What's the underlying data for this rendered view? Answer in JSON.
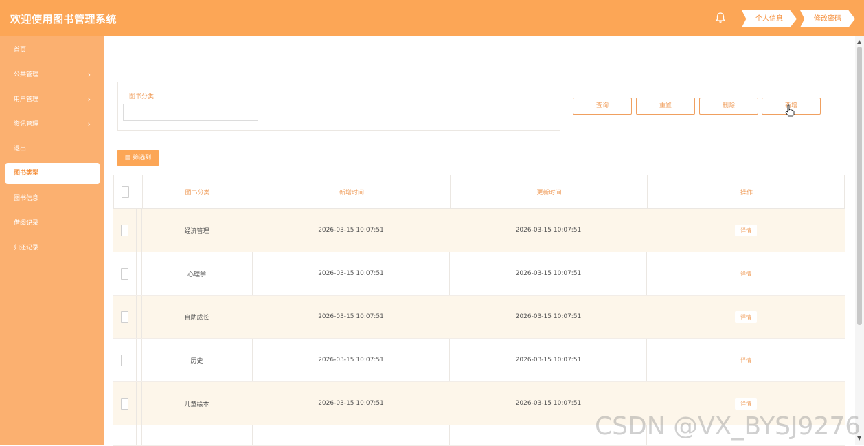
{
  "header": {
    "title": "欢迎使用图书管理系统",
    "profile_label": "个人信息",
    "password_label": "修改密码",
    "bell_icon": "bell-icon"
  },
  "sidebar": {
    "items": [
      {
        "label": "首页",
        "chevron": false
      },
      {
        "label": "公共管理",
        "chevron": true
      },
      {
        "label": "用户管理",
        "chevron": true
      },
      {
        "label": "资讯管理",
        "chevron": true
      },
      {
        "label": "退出",
        "chevron": false
      },
      {
        "label": "图书类型",
        "chevron": false,
        "active": true
      },
      {
        "label": "图书信息",
        "chevron": false
      },
      {
        "label": "借阅记录",
        "chevron": false
      },
      {
        "label": "归还记录",
        "chevron": false
      }
    ]
  },
  "search": {
    "label": "图书分类",
    "value": ""
  },
  "actions": {
    "query": "查询",
    "reset": "重置",
    "delete": "删除",
    "add": "新增",
    "filter": "筛选列"
  },
  "table": {
    "columns": [
      "图书分类",
      "新增时间",
      "更新时间",
      "操作"
    ],
    "rows": [
      {
        "category": "经济管理",
        "created": "2026-03-15 10:07:51",
        "updated": "2026-03-15 10:07:51",
        "action": "详情"
      },
      {
        "category": "心理学",
        "created": "2026-03-15 10:07:51",
        "updated": "2026-03-15 10:07:51",
        "action": "详情"
      },
      {
        "category": "自助成长",
        "created": "2026-03-15 10:07:51",
        "updated": "2026-03-15 10:07:51",
        "action": "详情"
      },
      {
        "category": "历史",
        "created": "2026-03-15 10:07:51",
        "updated": "2026-03-15 10:07:51",
        "action": "详情"
      },
      {
        "category": "儿童绘本",
        "created": "2026-03-15 10:07:51",
        "updated": "2026-03-15 10:07:51",
        "action": "详情"
      }
    ]
  },
  "watermark": "CSDN @VX_BYSJ9276",
  "colors": {
    "accent": "#fca656",
    "sidebar": "#fbb070",
    "row_alt": "#fdf6ea"
  }
}
